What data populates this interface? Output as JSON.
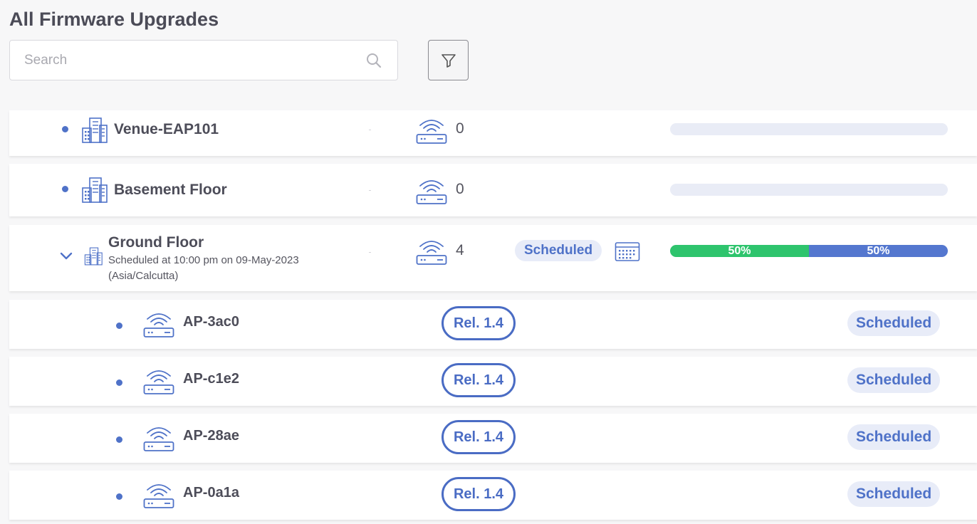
{
  "page": {
    "title": "All Firmware Upgrades"
  },
  "search": {
    "placeholder": "Search",
    "value": ""
  },
  "venues": [
    {
      "name": "Venue-EAP101",
      "device_count": "0"
    },
    {
      "name": "Basement Floor",
      "device_count": "0"
    },
    {
      "name": "Ground Floor",
      "schedule_line1": "Scheduled at 10:00 pm on 09-May-2023",
      "schedule_line2": "(Asia/Calcutta)",
      "device_count": "4",
      "status": "Scheduled",
      "progress": [
        {
          "label": "50%",
          "percent": 50
        },
        {
          "label": "50%",
          "percent": 50
        }
      ]
    }
  ],
  "devices": [
    {
      "name": "AP-3ac0",
      "release": "Rel. 1.4",
      "status": "Scheduled"
    },
    {
      "name": "AP-c1e2",
      "release": "Rel. 1.4",
      "status": "Scheduled"
    },
    {
      "name": "AP-28ae",
      "release": "Rel. 1.4",
      "status": "Scheduled"
    },
    {
      "name": "AP-0a1a",
      "release": "Rel. 1.4",
      "status": "Scheduled"
    }
  ],
  "colors": {
    "accent": "#4f72c8",
    "progress_green": "#2ec46d",
    "progress_blue": "#5477cf",
    "badge_bg": "#e8ecf8"
  },
  "icons": {
    "search": "search-icon",
    "filter": "filter-icon",
    "venue": "building-icon",
    "device": "access-point-icon",
    "calendar": "calendar-icon",
    "expand": "chevron-down-icon"
  }
}
